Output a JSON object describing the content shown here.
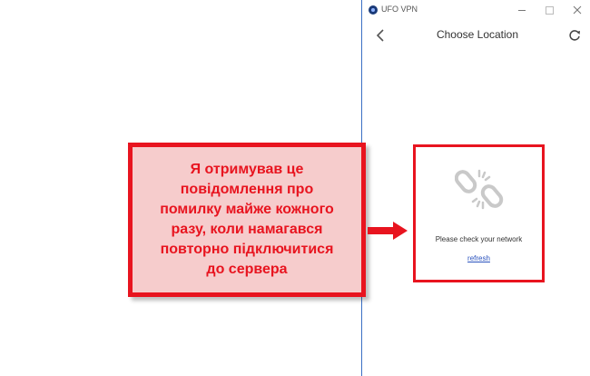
{
  "window": {
    "title": "UFO VPN"
  },
  "header": {
    "title": "Choose Location"
  },
  "error": {
    "message": "Please check your network",
    "refresh_link": "refresh"
  },
  "annotation": {
    "text": "Я отримував це\nповідомлення про\nпомилку майже кожного\nразу, коли намагався\nповторно підключитися\nдо сервера"
  },
  "colors": {
    "accent_red": "#e8141f",
    "callout_fill": "#f6cccc",
    "link_blue": "#2a52be",
    "window_border": "#3b6fc4"
  },
  "icons": [
    "app-logo-icon",
    "minimize-icon",
    "maximize-icon",
    "close-icon",
    "back-arrow-icon",
    "refresh-icon",
    "broken-link-icon",
    "right-arrow-icon"
  ]
}
